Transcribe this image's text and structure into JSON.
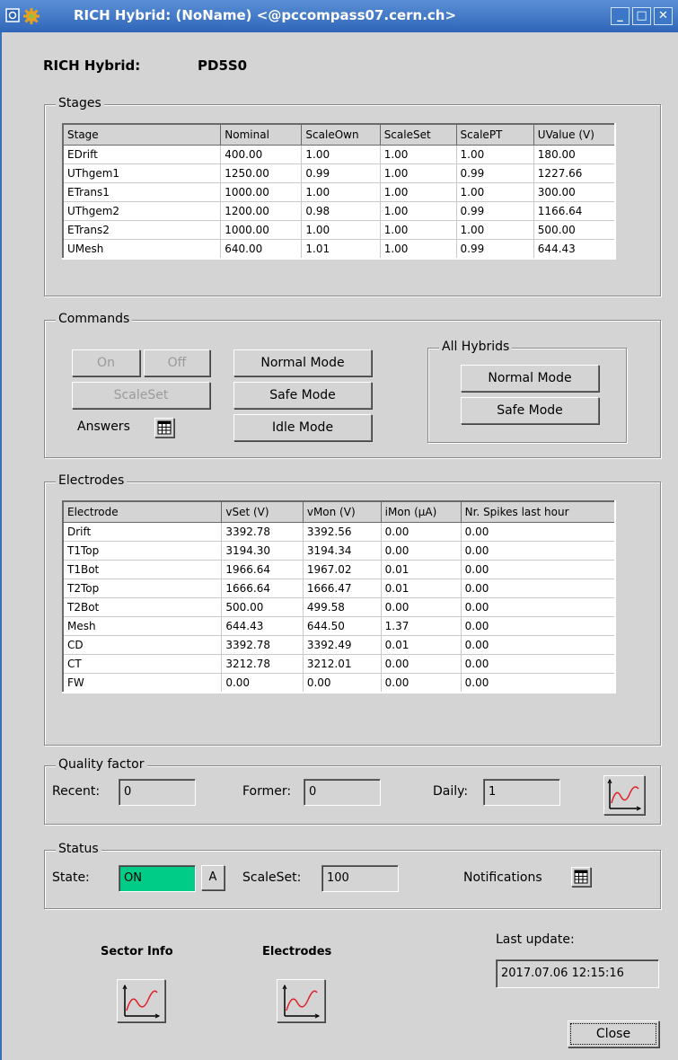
{
  "window": {
    "title": "RICH Hybrid: (NoName) <@pccompass07.cern.ch>"
  },
  "header": {
    "label": "RICH Hybrid:",
    "value": "PD5S0"
  },
  "stages": {
    "title": "Stages",
    "columns": [
      "Stage",
      "Nominal",
      "ScaleOwn",
      "ScaleSet",
      "ScalePT",
      "UValue (V)"
    ],
    "rows": [
      [
        "EDrift",
        "400.00",
        "1.00",
        "1.00",
        "1.00",
        "180.00"
      ],
      [
        "UThgem1",
        "1250.00",
        "0.99",
        "1.00",
        "0.99",
        "1227.66"
      ],
      [
        "ETrans1",
        "1000.00",
        "1.00",
        "1.00",
        "1.00",
        "300.00"
      ],
      [
        "UThgem2",
        "1200.00",
        "0.98",
        "1.00",
        "0.99",
        "1166.64"
      ],
      [
        "ETrans2",
        "1000.00",
        "1.00",
        "1.00",
        "1.00",
        "500.00"
      ],
      [
        "UMesh",
        "640.00",
        "1.01",
        "1.00",
        "0.99",
        "644.43"
      ]
    ]
  },
  "commands": {
    "title": "Commands",
    "on": "On",
    "off": "Off",
    "scaleset": "ScaleSet",
    "answers": "Answers",
    "normal_mode": "Normal Mode",
    "safe_mode": "Safe Mode",
    "idle_mode": "Idle Mode",
    "all_hybrids": {
      "title": "All Hybrids",
      "normal_mode": "Normal Mode",
      "safe_mode": "Safe Mode"
    }
  },
  "electrodes": {
    "title": "Electrodes",
    "columns": [
      "Electrode",
      "vSet (V)",
      "vMon (V)",
      "iMon (µA)",
      "Nr. Spikes last hour"
    ],
    "rows": [
      [
        "Drift",
        "3392.78",
        "3392.56",
        "0.00",
        "0.00"
      ],
      [
        "T1Top",
        "3194.30",
        "3194.34",
        "0.00",
        "0.00"
      ],
      [
        "T1Bot",
        "1966.64",
        "1967.02",
        "0.01",
        "0.00"
      ],
      [
        "T2Top",
        "1666.64",
        "1666.47",
        "0.01",
        "0.00"
      ],
      [
        "T2Bot",
        "500.00",
        "499.58",
        "0.00",
        "0.00"
      ],
      [
        "Mesh",
        "644.43",
        "644.50",
        "1.37",
        "0.00"
      ],
      [
        "CD",
        "3392.78",
        "3392.49",
        "0.01",
        "0.00"
      ],
      [
        "CT",
        "3212.78",
        "3212.01",
        "0.00",
        "0.00"
      ],
      [
        "FW",
        "0.00",
        "0.00",
        "0.00",
        "0.00"
      ]
    ]
  },
  "quality": {
    "title": "Quality factor",
    "recent_label": "Recent:",
    "recent_value": "0",
    "former_label": "Former:",
    "former_value": "0",
    "daily_label": "Daily:",
    "daily_value": "1"
  },
  "status": {
    "title": "Status",
    "state_label": "State:",
    "state_value": "ON",
    "state_color": "#00cc88",
    "a_button": "A",
    "scaleset_label": "ScaleSet:",
    "scaleset_value": "100",
    "notifications_label": "Notifications"
  },
  "footer": {
    "sector_info": "Sector Info",
    "electrodes": "Electrodes",
    "last_update_label": "Last update:",
    "last_update_value": "2017.07.06 12:15:16",
    "close": "Close"
  },
  "icons": [
    "window-menu-icon",
    "gear-icon",
    "minimize-icon",
    "maximize-icon",
    "close-icon",
    "table-icon",
    "trend-chart-icon"
  ]
}
